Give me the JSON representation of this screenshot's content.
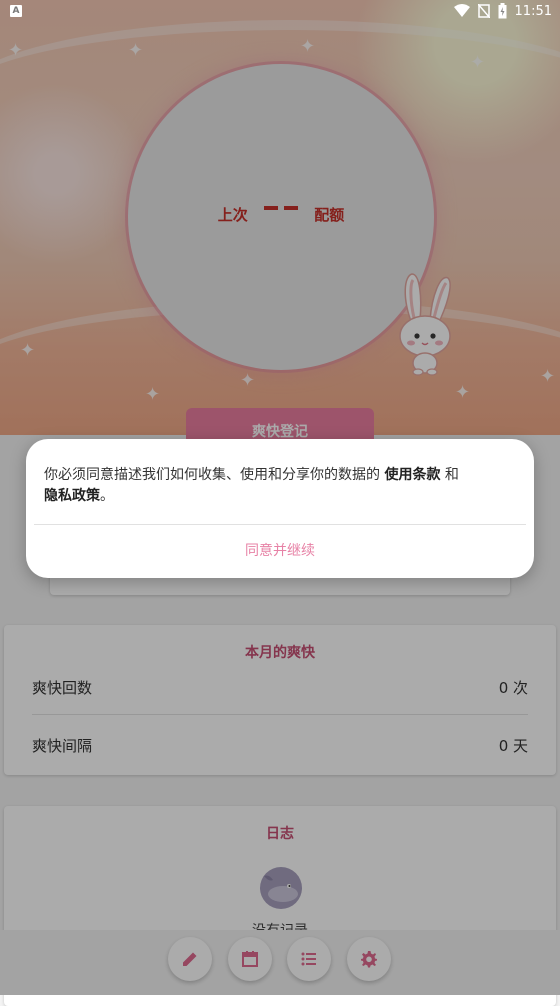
{
  "status_bar": {
    "time": "11:51"
  },
  "hero": {
    "left_label": "上次",
    "right_label": "配额"
  },
  "record_button": {
    "label": "爽快登记"
  },
  "month_card": {
    "title": "本月的爽快",
    "rows": [
      {
        "label": "爽快回数",
        "value": "0 次"
      },
      {
        "label": "爽快间隔",
        "value": "0 天"
      }
    ]
  },
  "log_card": {
    "title": "日志",
    "empty_text": "没有记录"
  },
  "bottom_nav": {
    "items": [
      {
        "icon": "pencil-icon"
      },
      {
        "icon": "calendar-icon"
      },
      {
        "icon": "list-icon"
      },
      {
        "icon": "gear-icon"
      }
    ]
  },
  "dialog": {
    "message_before": "你必须同意描述我们如何收集、使用和分享你的数据的 ",
    "terms_link": "使用条款",
    "message_and": " 和",
    "privacy_link": "隐私政策",
    "message_end": "。",
    "confirm_button": "同意并继续"
  },
  "colors": {
    "accent_pink": "#e782a6",
    "title_pink": "#c64f74",
    "ring_red": "#c6302a"
  }
}
